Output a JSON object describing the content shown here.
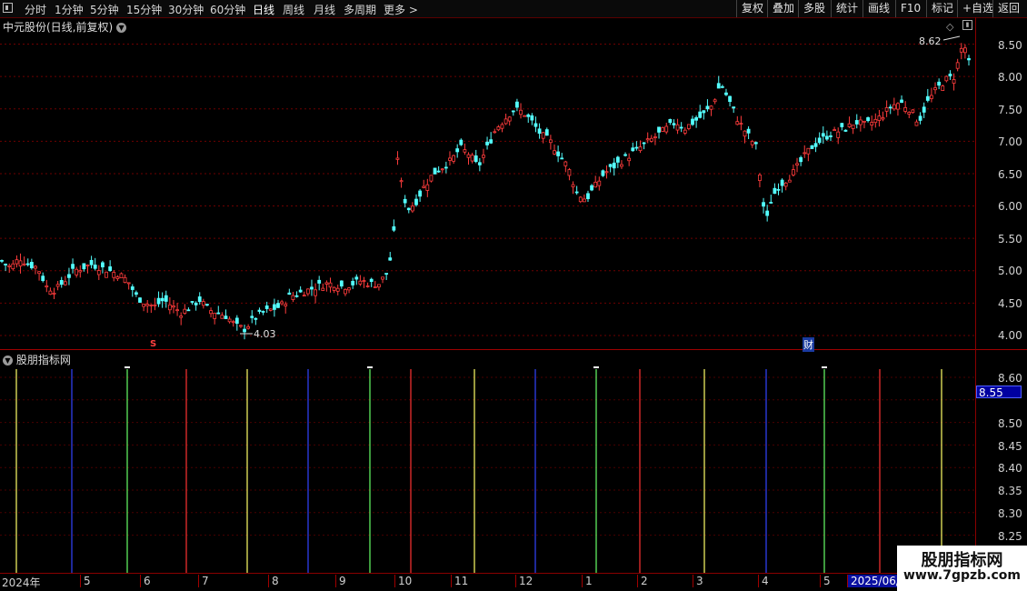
{
  "toolbar": {
    "periods": [
      "分时",
      "1分钟",
      "5分钟",
      "15分钟",
      "30分钟",
      "60分钟",
      "日线",
      "周线",
      "月线",
      "多周期",
      "更多 >"
    ],
    "active_period": "日线",
    "right_buttons": [
      "复权",
      "叠加",
      "多股",
      "统计",
      "画线",
      "F10",
      "标记",
      "+自选",
      "返回"
    ]
  },
  "main_chart": {
    "title": "中元股份(日线,前复权)",
    "y_ticks": [
      "8.50",
      "8.00",
      "7.50",
      "7.00",
      "6.50",
      "6.00",
      "5.50",
      "5.00",
      "4.50",
      "4.00"
    ],
    "high_marker": "8.62",
    "low_marker": "4.03",
    "event_marker_s": "S",
    "event_marker_cai": "财"
  },
  "indicator": {
    "title": "股朋指标网",
    "y_ticks": [
      "8.60",
      "8.55",
      "8.50",
      "8.45",
      "8.40",
      "8.35",
      "8.30",
      "8.25"
    ],
    "current_value": "8.55"
  },
  "x_axis": {
    "labels": [
      "2024年",
      "5",
      "6",
      "7",
      "8",
      "9",
      "10",
      "11",
      "12",
      "1",
      "2",
      "3",
      "4",
      "5",
      "2025/06/"
    ]
  },
  "watermark": {
    "text": "股朋指标网",
    "url": "www.7gpzb.com"
  },
  "colors": {
    "up": "#ff3c3c",
    "down": "#54ffff",
    "grid": "#7a0000",
    "accent_blue": "#0000a0"
  },
  "chart_data": {
    "type": "candlestick",
    "ylim": [
      3.9,
      8.75
    ],
    "indicator_ylim": [
      8.22,
      8.66
    ],
    "indicator_line_colors": [
      "#ffff66",
      "#3344ff",
      "#66ff66",
      "#ff3333",
      "#ffff66",
      "#3344ff",
      "#66ff66",
      "#ff3333",
      "#ffff66",
      "#3344ff",
      "#66ff66",
      "#ff3333",
      "#ffff66",
      "#3344ff",
      "#66ff66",
      "#ff3333",
      "#ffff66"
    ],
    "close_path": [
      [
        0,
        5.15
      ],
      [
        5,
        5.05
      ],
      [
        10,
        5.2
      ],
      [
        15,
        5.1
      ],
      [
        20,
        5.05
      ],
      [
        25,
        4.75
      ],
      [
        30,
        4.7
      ],
      [
        35,
        4.85
      ],
      [
        40,
        5.0
      ],
      [
        45,
        5.05
      ],
      [
        50,
        5.1
      ],
      [
        55,
        5.05
      ],
      [
        60,
        5.0
      ],
      [
        65,
        4.95
      ],
      [
        70,
        4.85
      ],
      [
        75,
        4.6
      ],
      [
        80,
        4.5
      ],
      [
        85,
        4.45
      ],
      [
        90,
        4.55
      ],
      [
        95,
        4.45
      ],
      [
        100,
        4.35
      ],
      [
        105,
        4.45
      ],
      [
        110,
        4.55
      ],
      [
        115,
        4.4
      ],
      [
        120,
        4.35
      ],
      [
        125,
        4.3
      ],
      [
        130,
        4.15
      ],
      [
        135,
        4.1
      ],
      [
        140,
        4.25
      ],
      [
        145,
        4.35
      ],
      [
        150,
        4.4
      ],
      [
        155,
        4.45
      ],
      [
        160,
        4.6
      ],
      [
        165,
        4.65
      ],
      [
        170,
        4.7
      ],
      [
        175,
        4.75
      ],
      [
        180,
        4.8
      ],
      [
        185,
        4.8
      ],
      [
        190,
        4.75
      ],
      [
        195,
        4.8
      ],
      [
        200,
        4.85
      ],
      [
        205,
        4.8
      ],
      [
        210,
        4.8
      ],
      [
        215,
        5.0
      ],
      [
        218,
        5.5
      ],
      [
        220,
        6.8
      ],
      [
        223,
        6.2
      ],
      [
        226,
        5.95
      ],
      [
        230,
        6.05
      ],
      [
        235,
        6.3
      ],
      [
        240,
        6.5
      ],
      [
        245,
        6.6
      ],
      [
        250,
        6.7
      ],
      [
        255,
        6.9
      ],
      [
        260,
        6.8
      ],
      [
        265,
        6.6
      ],
      [
        270,
        6.9
      ],
      [
        275,
        7.2
      ],
      [
        280,
        7.35
      ],
      [
        285,
        7.5
      ],
      [
        290,
        7.45
      ],
      [
        295,
        7.3
      ],
      [
        300,
        7.1
      ],
      [
        305,
        7.0
      ],
      [
        310,
        6.8
      ],
      [
        315,
        6.6
      ],
      [
        320,
        6.2
      ],
      [
        325,
        6.1
      ],
      [
        330,
        6.3
      ],
      [
        335,
        6.5
      ],
      [
        340,
        6.6
      ],
      [
        345,
        6.7
      ],
      [
        350,
        6.8
      ],
      [
        355,
        6.9
      ],
      [
        360,
        7.0
      ],
      [
        365,
        7.1
      ],
      [
        370,
        7.2
      ],
      [
        375,
        7.3
      ],
      [
        380,
        7.2
      ],
      [
        385,
        7.3
      ],
      [
        390,
        7.4
      ],
      [
        395,
        7.55
      ],
      [
        400,
        7.9
      ],
      [
        405,
        7.6
      ],
      [
        410,
        7.3
      ],
      [
        415,
        7.1
      ],
      [
        420,
        6.9
      ],
      [
        425,
        5.7
      ],
      [
        428,
        6.1
      ],
      [
        432,
        6.3
      ],
      [
        436,
        6.4
      ],
      [
        440,
        6.5
      ],
      [
        445,
        6.7
      ],
      [
        450,
        6.9
      ],
      [
        455,
        7.0
      ],
      [
        460,
        7.1
      ],
      [
        465,
        7.15
      ],
      [
        470,
        7.2
      ],
      [
        475,
        7.3
      ],
      [
        480,
        7.25
      ],
      [
        485,
        7.3
      ],
      [
        490,
        7.4
      ],
      [
        495,
        7.55
      ],
      [
        500,
        7.6
      ],
      [
        505,
        7.5
      ],
      [
        510,
        7.3
      ],
      [
        515,
        7.6
      ],
      [
        520,
        7.8
      ],
      [
        525,
        7.95
      ],
      [
        530,
        8.0
      ],
      [
        535,
        8.55
      ],
      [
        538,
        8.2
      ]
    ]
  }
}
